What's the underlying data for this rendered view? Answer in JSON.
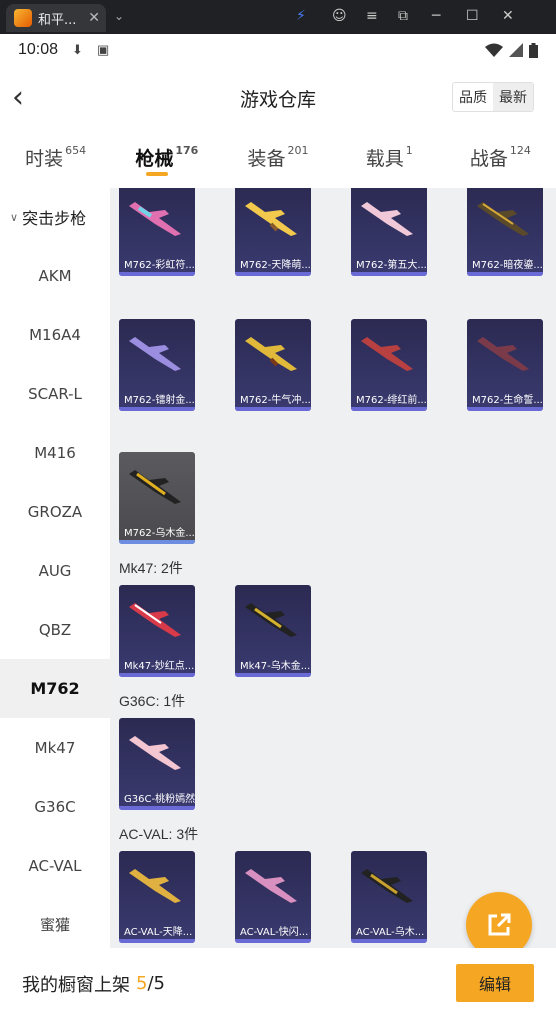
{
  "window": {
    "tab_title": "和平...",
    "tab_close": "✕",
    "dropdown": "⌄",
    "controls": [
      "⚡",
      "☺",
      "≡",
      "⧉",
      "─",
      "☐",
      "✕"
    ]
  },
  "status_bar": {
    "time": "10:08"
  },
  "header": {
    "back": "‹",
    "title": "游戏仓库",
    "sort_options": [
      "品质",
      "最新"
    ]
  },
  "categories": [
    {
      "label": "时装",
      "count": "654"
    },
    {
      "label": "枪械",
      "count": "176"
    },
    {
      "label": "装备",
      "count": "201"
    },
    {
      "label": "载具",
      "count": "1"
    },
    {
      "label": "战备",
      "count": "124"
    }
  ],
  "sidebar": {
    "group": "突击步枪",
    "items": [
      "AKM",
      "M16A4",
      "SCAR-L",
      "M416",
      "GROZA",
      "AUG",
      "QBZ",
      "M762",
      "Mk47",
      "G36C",
      "AC-VAL",
      "蜜獾"
    ],
    "active": "M762"
  },
  "sections": {
    "mk47": "Mk47: 2件",
    "g36c": "G36C: 1件",
    "acval": "AC-VAL: 3件"
  },
  "cards": {
    "m762_1": "M762-彩虹符...",
    "m762_2": "M762-天降萌...",
    "m762_3": "M762-第五大...",
    "m762_4": "M762-暗夜鎏...",
    "m762_5": "M762-镭射金...",
    "m762_6": "M762-牛气冲...",
    "m762_7": "M762-绯红前...",
    "m762_8": "M762-生命誓...",
    "m762_9": "M762-乌木金...",
    "mk47_1": "Mk47-妙红点...",
    "mk47_2": "Mk47-乌木金...",
    "g36c_1": "G36C-桃粉嫣然",
    "acval_1": "AC-VAL-天降...",
    "acval_2": "AC-VAL-快闪...",
    "acval_3": "AC-VAL-乌木..."
  },
  "footer": {
    "label": "我的橱窗上架",
    "current": "5",
    "total": "/5",
    "edit": "编辑"
  },
  "colors": {
    "accent": "#f5a623",
    "card_bg": "#2b2a52",
    "card_bar": "#6a6ad6"
  }
}
